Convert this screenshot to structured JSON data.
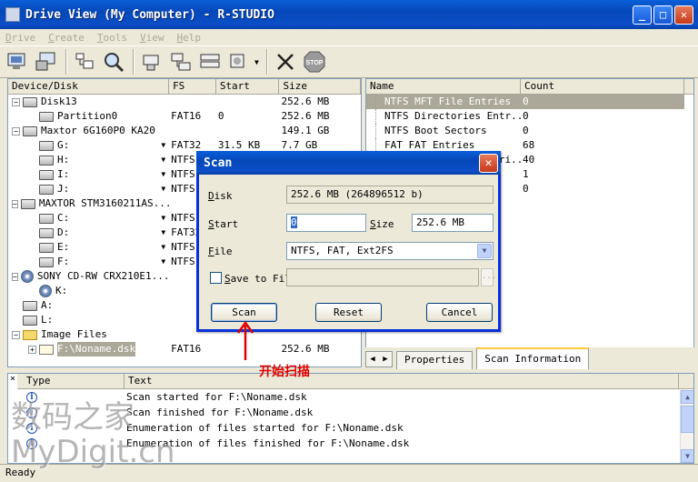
{
  "window": {
    "title": "Drive View (My Computer) - R-STUDIO",
    "controls": {
      "minimize": "_",
      "maximize": "□",
      "close": "✕"
    }
  },
  "menu": [
    "Drive",
    "Create",
    "Tools",
    "View",
    "Help"
  ],
  "toolbar_icons": [
    "connect-computer-icon",
    "remote-connect-icon",
    "open-drive-files-icon",
    "scan-icon",
    "create-region-icon",
    "create-image-icon",
    "open-image-icon",
    "create-virtual-raid-icon",
    "remove-icon",
    "stop-icon"
  ],
  "toolbar_labels": {
    "stop": "STOP"
  },
  "drive_table": {
    "headers": {
      "device": "Device/Disk",
      "fs": "FS",
      "start": "Start",
      "size": "Size"
    },
    "rows": [
      {
        "level": 0,
        "expander": "−",
        "icon": "disk",
        "name": "Disk13",
        "fs": "",
        "start": "",
        "size": "252.6 MB",
        "dropdown": false
      },
      {
        "level": 1,
        "expander": "",
        "icon": "disk",
        "name": "Partition0",
        "fs": "FAT16",
        "start": "0",
        "size": "252.6 MB",
        "dropdown": false
      },
      {
        "level": 0,
        "expander": "−",
        "icon": "disk",
        "name": "Maxtor 6G160P0 KA20",
        "fs": "",
        "start": "",
        "size": "149.1 GB",
        "dropdown": false
      },
      {
        "level": 1,
        "expander": "",
        "icon": "disk",
        "name": "G:",
        "fs": "FAT32",
        "start": "31.5 KB",
        "size": "7.7 GB",
        "dropdown": true
      },
      {
        "level": 1,
        "expander": "",
        "icon": "disk",
        "name": "H:",
        "fs": "NTFS",
        "start": "",
        "size": "",
        "dropdown": true
      },
      {
        "level": 1,
        "expander": "",
        "icon": "disk",
        "name": "I:",
        "fs": "NTFS",
        "start": "",
        "size": "",
        "dropdown": true
      },
      {
        "level": 1,
        "expander": "",
        "icon": "disk",
        "name": "J:",
        "fs": "NTFS",
        "start": "",
        "size": "",
        "dropdown": true
      },
      {
        "level": 0,
        "expander": "−",
        "icon": "disk",
        "name": "MAXTOR STM3160211AS...",
        "fs": "",
        "start": "",
        "size": "",
        "dropdown": false
      },
      {
        "level": 1,
        "expander": "",
        "icon": "disk",
        "name": "C:",
        "fs": "NTFS",
        "start": "",
        "size": "",
        "dropdown": true
      },
      {
        "level": 1,
        "expander": "",
        "icon": "disk",
        "name": "D:",
        "fs": "FAT32",
        "start": "",
        "size": "",
        "dropdown": true
      },
      {
        "level": 1,
        "expander": "",
        "icon": "disk",
        "name": "E:",
        "fs": "NTFS",
        "start": "",
        "size": "",
        "dropdown": true
      },
      {
        "level": 1,
        "expander": "",
        "icon": "disk",
        "name": "F:",
        "fs": "NTFS",
        "start": "",
        "size": "",
        "dropdown": true
      },
      {
        "level": 0,
        "expander": "−",
        "icon": "cd",
        "name": "SONY CD-RW CRX210E1...",
        "fs": "",
        "start": "",
        "size": "",
        "dropdown": false
      },
      {
        "level": 1,
        "expander": "",
        "icon": "cd",
        "name": "K:",
        "fs": "",
        "start": "",
        "size": "",
        "dropdown": false
      },
      {
        "level": 0,
        "expander": "",
        "icon": "disk",
        "name": "A:",
        "fs": "",
        "start": "",
        "size": "",
        "dropdown": false
      },
      {
        "level": 0,
        "expander": "",
        "icon": "disk",
        "name": "L:",
        "fs": "",
        "start": "",
        "size": "",
        "dropdown": false
      },
      {
        "level": 0,
        "expander": "−",
        "icon": "folder",
        "name": "Image Files",
        "fs": "",
        "start": "",
        "size": "",
        "dropdown": false
      },
      {
        "level": 1,
        "expander": "+",
        "icon": "img",
        "name": "F:\\Noname.dsk",
        "fs": "FAT16",
        "start": "",
        "size": "252.6 MB",
        "dropdown": false,
        "selected": true
      }
    ]
  },
  "info_table": {
    "headers": {
      "name": "Name",
      "count": "Count"
    },
    "rows": [
      {
        "name": "NTFS MFT File Entries",
        "count": "0",
        "selected": true
      },
      {
        "name": "NTFS Directories Entr...",
        "count": "0"
      },
      {
        "name": "NTFS Boot Sectors",
        "count": "0"
      },
      {
        "name": "FAT FAT Entries",
        "count": "68"
      },
      {
        "name": "FAT Directories Entri...",
        "count": "40"
      },
      {
        "name": "",
        "count": "1"
      },
      {
        "name": "",
        "count": "0"
      }
    ]
  },
  "tabs": [
    "Properties",
    "Scan Information"
  ],
  "log": {
    "headers": {
      "type": "Type",
      "text": "Text"
    },
    "close": "×",
    "rows": [
      {
        "icon": "i",
        "text": "Scan started for F:\\Noname.dsk"
      },
      {
        "icon": "i",
        "text": "Scan finished for F:\\Noname.dsk"
      },
      {
        "icon": "i",
        "text": "Enumeration of files started for F:\\Noname.dsk"
      },
      {
        "icon": "i",
        "text": "Enumeration of files finished for F:\\Noname.dsk"
      }
    ]
  },
  "status": "Ready",
  "dialog": {
    "title": "Scan",
    "close": "✕",
    "disk_label": "Disk",
    "disk_value": "252.6 MB (264896512 b)",
    "start_label": "Start",
    "start_value": "0",
    "size_label": "Size",
    "size_value": "252.6 MB",
    "file_label": "File",
    "file_value": "NTFS, FAT, Ext2FS",
    "save_label": "Save to Fil",
    "save_checked": false,
    "save_path": "",
    "browse_label": "...",
    "buttons": {
      "scan": "Scan",
      "reset": "Reset",
      "cancel": "Cancel"
    }
  },
  "annotation": "开始扫描",
  "watermark": {
    "line1": "数码之家",
    "line2": "MyDigit.cn"
  },
  "colors": {
    "titlebar": "#0548b9",
    "selection": "#aca899",
    "annotation": "#e00000",
    "dialog_border": "#0831d9"
  }
}
